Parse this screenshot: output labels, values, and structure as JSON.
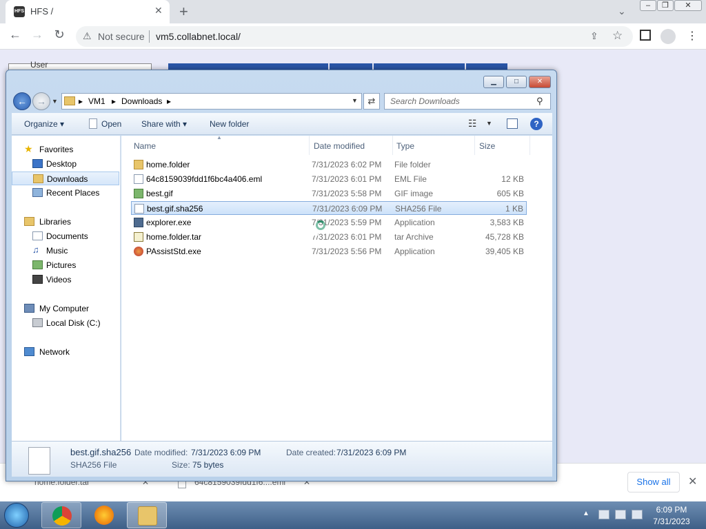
{
  "browser": {
    "tab_title": "HFS /",
    "favicon_text": "HFS",
    "new_tab": "+",
    "url_warning": "Not secure",
    "url": "vm5.collabnet.local/"
  },
  "page_behind": {
    "user_label": "User"
  },
  "downloads_bar": {
    "items": [
      "home.folder.tar",
      "64c8159039fdd1f6....eml"
    ],
    "show_all": "Show all"
  },
  "dialog": {
    "breadcrumb": [
      "VM1",
      "Downloads"
    ],
    "search_placeholder": "Search Downloads",
    "toolbar": {
      "organize": "Organize",
      "open": "Open",
      "share_with": "Share with",
      "new_folder": "New folder"
    },
    "nav": {
      "favorites": "Favorites",
      "desktop": "Desktop",
      "downloads": "Downloads",
      "recent_places": "Recent Places",
      "libraries": "Libraries",
      "documents": "Documents",
      "music": "Music",
      "pictures": "Pictures",
      "videos": "Videos",
      "my_computer": "My Computer",
      "local_disk": "Local Disk (C:)",
      "network": "Network"
    },
    "columns": {
      "name": "Name",
      "date_modified": "Date modified",
      "type": "Type",
      "size": "Size"
    },
    "files": [
      {
        "name": "home.folder",
        "date": "7/31/2023 6:02 PM",
        "type": "File folder",
        "size": ""
      },
      {
        "name": "64c8159039fdd1f6bc4a406.eml",
        "date": "7/31/2023 6:01 PM",
        "type": "EML File",
        "size": "12 KB"
      },
      {
        "name": "best.gif",
        "date": "7/31/2023 5:58 PM",
        "type": "GIF image",
        "size": "605 KB"
      },
      {
        "name": "best.gif.sha256",
        "date": "7/31/2023 6:09 PM",
        "type": "SHA256 File",
        "size": "1 KB"
      },
      {
        "name": "explorer.exe",
        "date": "7/31/2023 5:59 PM",
        "type": "Application",
        "size": "3,583 KB"
      },
      {
        "name": "home.folder.tar",
        "date": "7/31/2023 6:01 PM",
        "type": "tar Archive",
        "size": "45,728 KB"
      },
      {
        "name": "PAssistStd.exe",
        "date": "7/31/2023 5:56 PM",
        "type": "Application",
        "size": "39,405 KB"
      }
    ],
    "details": {
      "name": "best.gif.sha256",
      "type": "SHA256 File",
      "modified_label": "Date modified:",
      "modified_value": "7/31/2023 6:09 PM",
      "created_label": "Date created:",
      "created_value": "7/31/2023 6:09 PM",
      "size_label": "Size:",
      "size_value": "75 bytes"
    }
  },
  "taskbar": {
    "time": "6:09 PM",
    "date": "7/31/2023"
  }
}
